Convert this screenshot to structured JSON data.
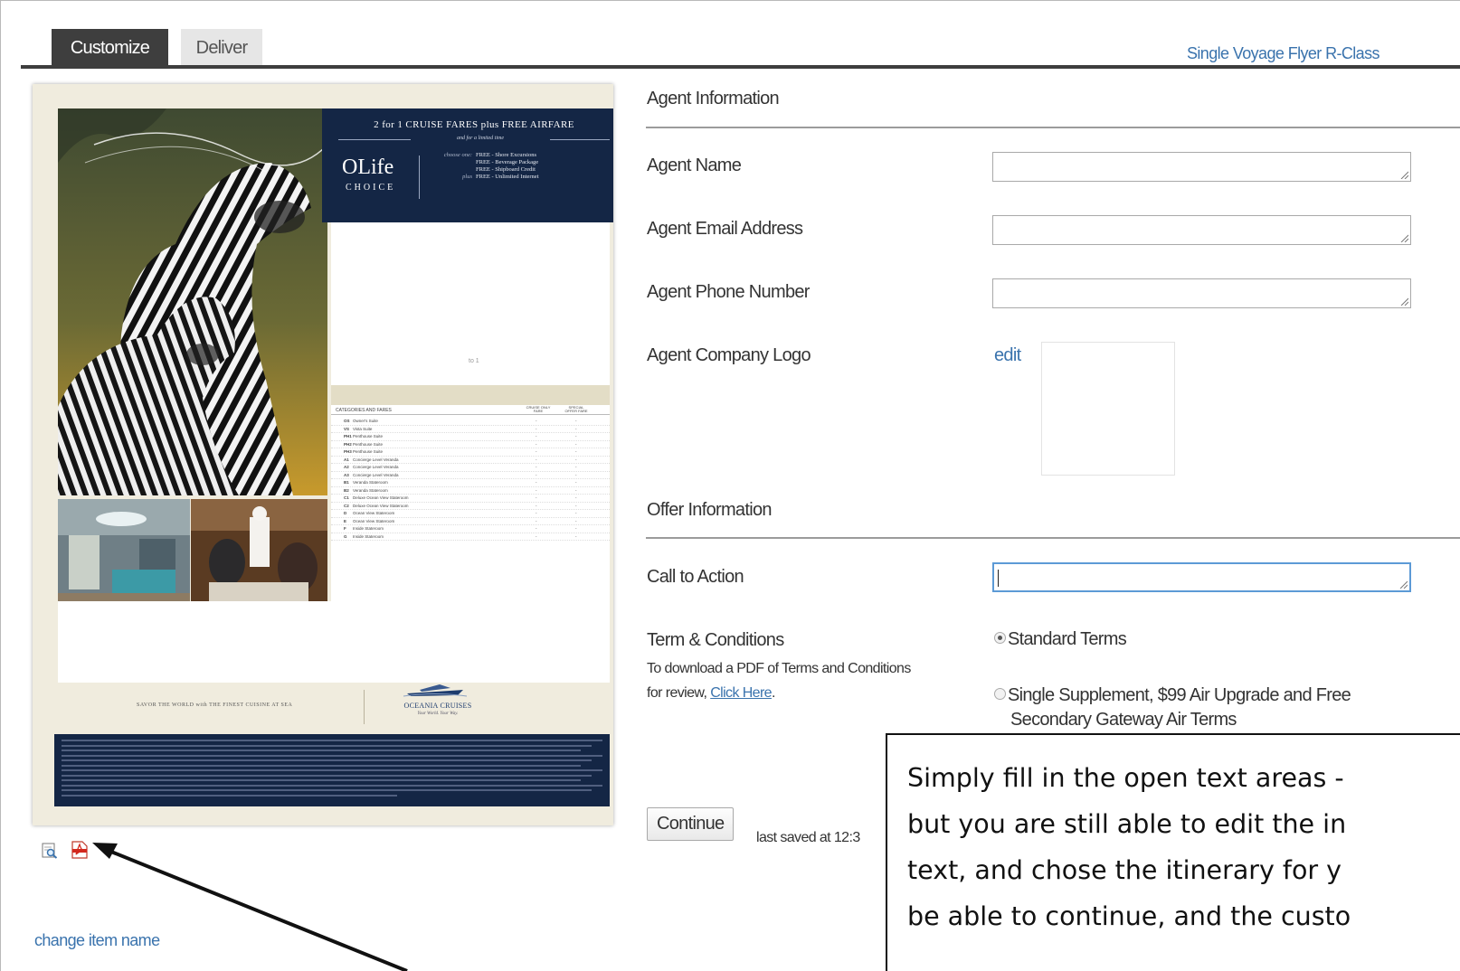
{
  "tabs": [
    {
      "label": "Customize",
      "active": true
    },
    {
      "label": "Deliver",
      "active": false
    }
  ],
  "template_title": "Single Voyage Flyer R-Class",
  "flyer": {
    "headline": "2 for 1 CRUISE FARES plus FREE AIRFARE",
    "subline": "and for a limited time",
    "logo_word": "OLife",
    "logo_sub": "CHOICE",
    "perk_prefix_1": "choose one:",
    "perk_prefix_2": "plus",
    "perks": [
      "FREE - Shore Excursions",
      "FREE - Beverage Package",
      "FREE - Shipboard Credit",
      "FREE - Unlimited Internet"
    ],
    "fare_header": "CATEGORIES AND FARES",
    "fare_col_1": "CRUISE ONLY FARE",
    "fare_col_2": "SPECIAL OFFER FARE",
    "fare_rows": [
      {
        "code": "OS",
        "name": "Owner's Suite"
      },
      {
        "code": "VS",
        "name": "Vista Suite"
      },
      {
        "code": "PH1",
        "name": "Penthouse Suite"
      },
      {
        "code": "PH2",
        "name": "Penthouse Suite"
      },
      {
        "code": "PH3",
        "name": "Penthouse Suite"
      },
      {
        "code": "A1",
        "name": "Concierge Level Veranda"
      },
      {
        "code": "A2",
        "name": "Concierge Level Veranda"
      },
      {
        "code": "A3",
        "name": "Concierge Level Veranda"
      },
      {
        "code": "B1",
        "name": "Veranda Stateroom"
      },
      {
        "code": "B2",
        "name": "Veranda Stateroom"
      },
      {
        "code": "C1",
        "name": "Deluxe Ocean View Stateroom"
      },
      {
        "code": "C2",
        "name": "Deluxe Ocean View Stateroom"
      },
      {
        "code": "D",
        "name": "Ocean View Stateroom"
      },
      {
        "code": "E",
        "name": "Ocean View Stateroom"
      },
      {
        "code": "F",
        "name": "Inside Stateroom"
      },
      {
        "code": "G",
        "name": "Inside Stateroom"
      }
    ],
    "savor_line": "SAVOR THE WORLD with THE FINEST CUISINE AT SEA",
    "brand": "OCEANIA CRUISES",
    "brand_tag": "Your World. Your Way."
  },
  "change_item_name": "change item name",
  "agent_section": {
    "heading": "Agent Information",
    "fields": [
      {
        "label": "Agent Name",
        "value": ""
      },
      {
        "label": "Agent Email Address",
        "value": ""
      },
      {
        "label": "Agent Phone Number",
        "value": ""
      }
    ],
    "logo_label": "Agent Company Logo",
    "logo_edit": "edit"
  },
  "offer_section": {
    "heading": "Offer Information",
    "cta_label": "Call to Action",
    "cta_value": "",
    "terms_label": "Term & Conditions",
    "terms_help_1": "To download a PDF of Terms and Conditions",
    "terms_help_2": "for review,",
    "terms_link": "Click Here",
    "terms_help_3": ".",
    "radio_options": [
      {
        "label": "Standard Terms",
        "checked": true
      },
      {
        "label": "Single Supplement, $99 Air Upgrade and Free",
        "checked": false
      }
    ],
    "radio_option_2_line_2": "Secondary Gateway Air Terms"
  },
  "continue_label": "Continue",
  "last_saved": "last saved at 12:3",
  "callout_lines": [
    "Simply fill in the open text areas -",
    "but you are still able to edit the in",
    "text, and chose the itinerary for y",
    "be able to continue, and the custo"
  ],
  "icons": {
    "preview": "preview-icon",
    "pdf": "pdf-icon",
    "resize": "resize-grip-icon"
  },
  "colors": {
    "tab_active": "#3e3e3e",
    "link": "#3a73ad",
    "flyer_navy": "#142645",
    "focus": "#5c9ad6"
  }
}
